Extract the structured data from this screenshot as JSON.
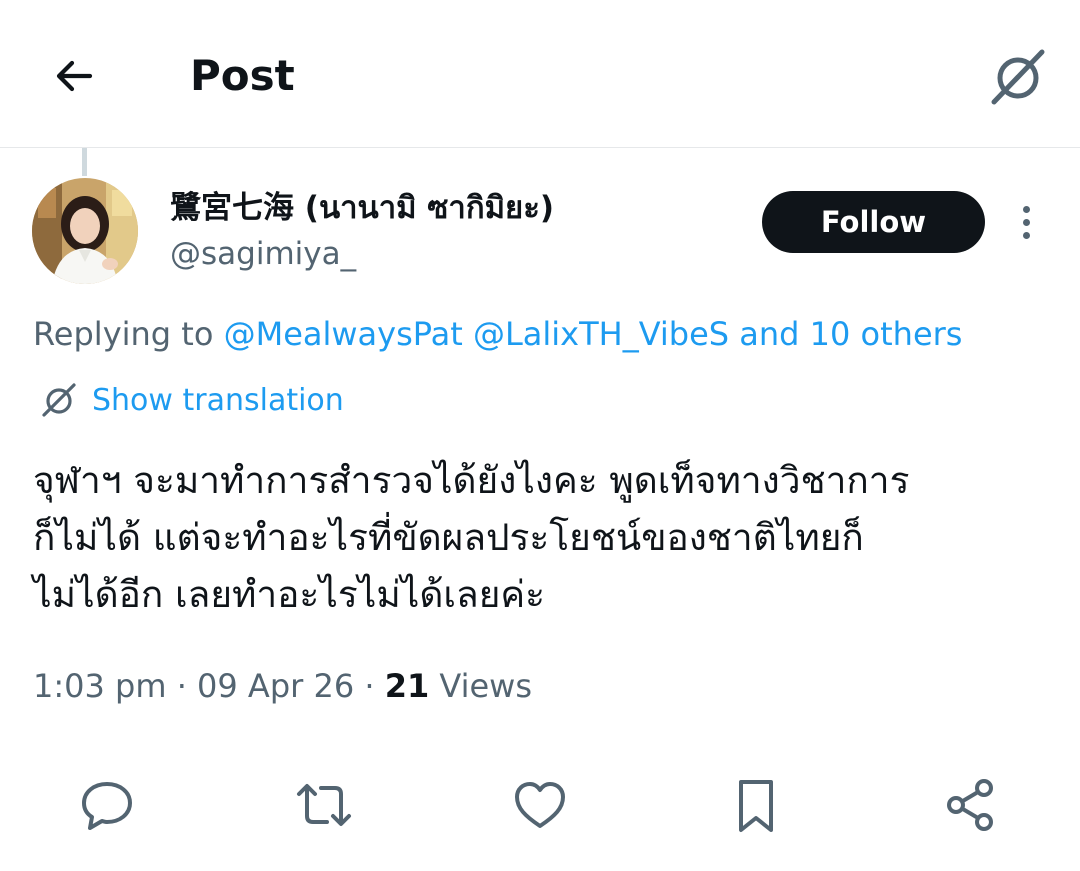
{
  "header": {
    "title": "Post",
    "back_icon": "arrow-left-icon",
    "translate_icon": "translate-icon"
  },
  "author": {
    "display_name": "鷺宮七海 (นานามิ ซากิมิยะ)",
    "handle": "@sagimiya_",
    "follow_label": "Follow",
    "avatar_icon": "avatar"
  },
  "reply": {
    "prefix": "Replying to",
    "mentions": "@MealwaysPat @LalixTH_VibeS and 10 others"
  },
  "translation": {
    "label": "Show translation"
  },
  "tweet": {
    "lines": [
      "จุฬาฯ จะมาทำการสำรวจได้ยังไงคะ พูดเท็จทางวิชาการ",
      "ก็ไม่ได้ แต่จะทำอะไรที่ขัดผลประโยชน์ของชาติไทยก็",
      "ไม่ได้อีก เลยทำอะไรไม่ได้เลยค่ะ"
    ]
  },
  "meta": {
    "time": "1:03 pm",
    "separator": "·",
    "date": "09 Apr 26",
    "views_count": "21",
    "views_label": "Views"
  },
  "actions": [
    "reply-icon",
    "repost-icon",
    "like-icon",
    "bookmark-icon",
    "share-icon"
  ],
  "colors": {
    "link": "#1d9bf0",
    "secondary_text": "#536471",
    "primary_text": "#0f1419",
    "follow_bg": "#0f1419"
  }
}
